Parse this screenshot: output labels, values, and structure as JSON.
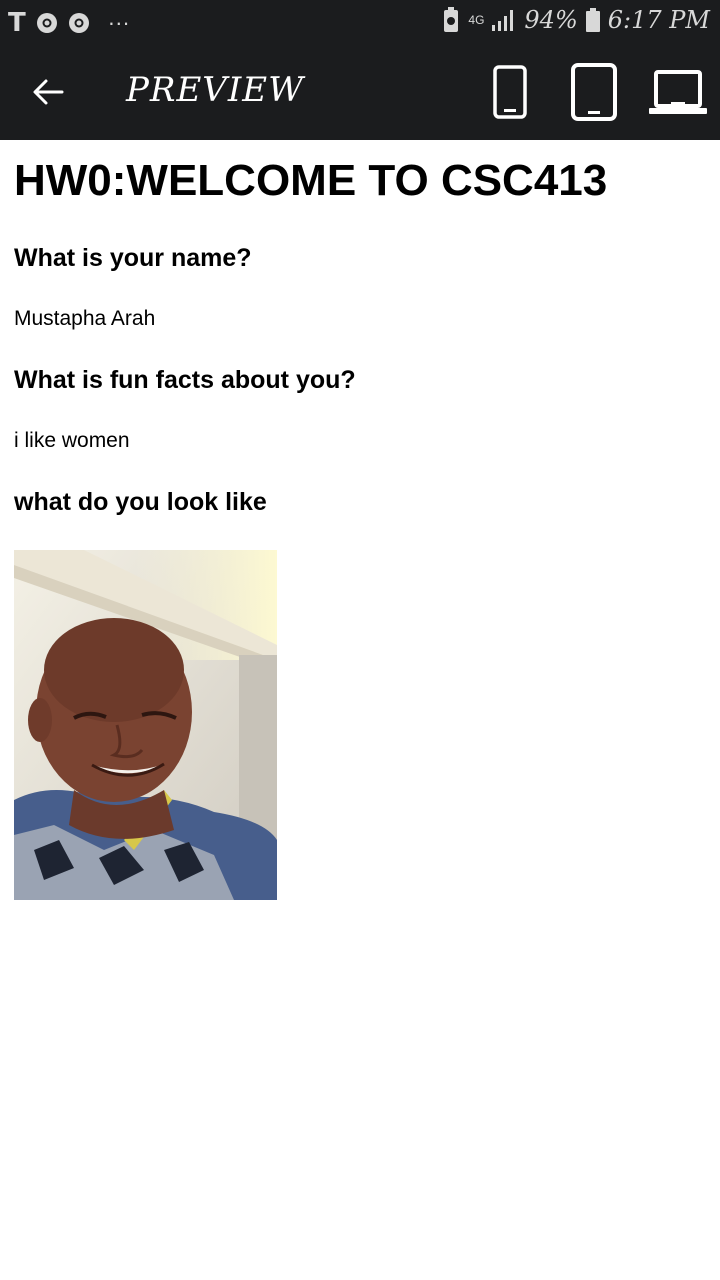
{
  "status_bar": {
    "battery_percent": "94%",
    "time": "6:17 PM",
    "network": "4G",
    "overflow": "···",
    "left_icons": [
      "t-app-icon",
      "chrome-icon",
      "chrome-icon"
    ]
  },
  "app_bar": {
    "title": "PREVIEW",
    "devices": [
      "phone-icon",
      "tablet-icon",
      "laptop-icon"
    ]
  },
  "page": {
    "heading": "HW0:WELCOME TO CSC413",
    "q1": "What is your name?",
    "a1": "Mustapha Arah",
    "q2": "What is fun facts about you?",
    "a2": "i like women",
    "q3": "what do you look like"
  },
  "colors": {
    "bar_bg": "#1b1c1e",
    "page_bg": "#ffffff"
  }
}
